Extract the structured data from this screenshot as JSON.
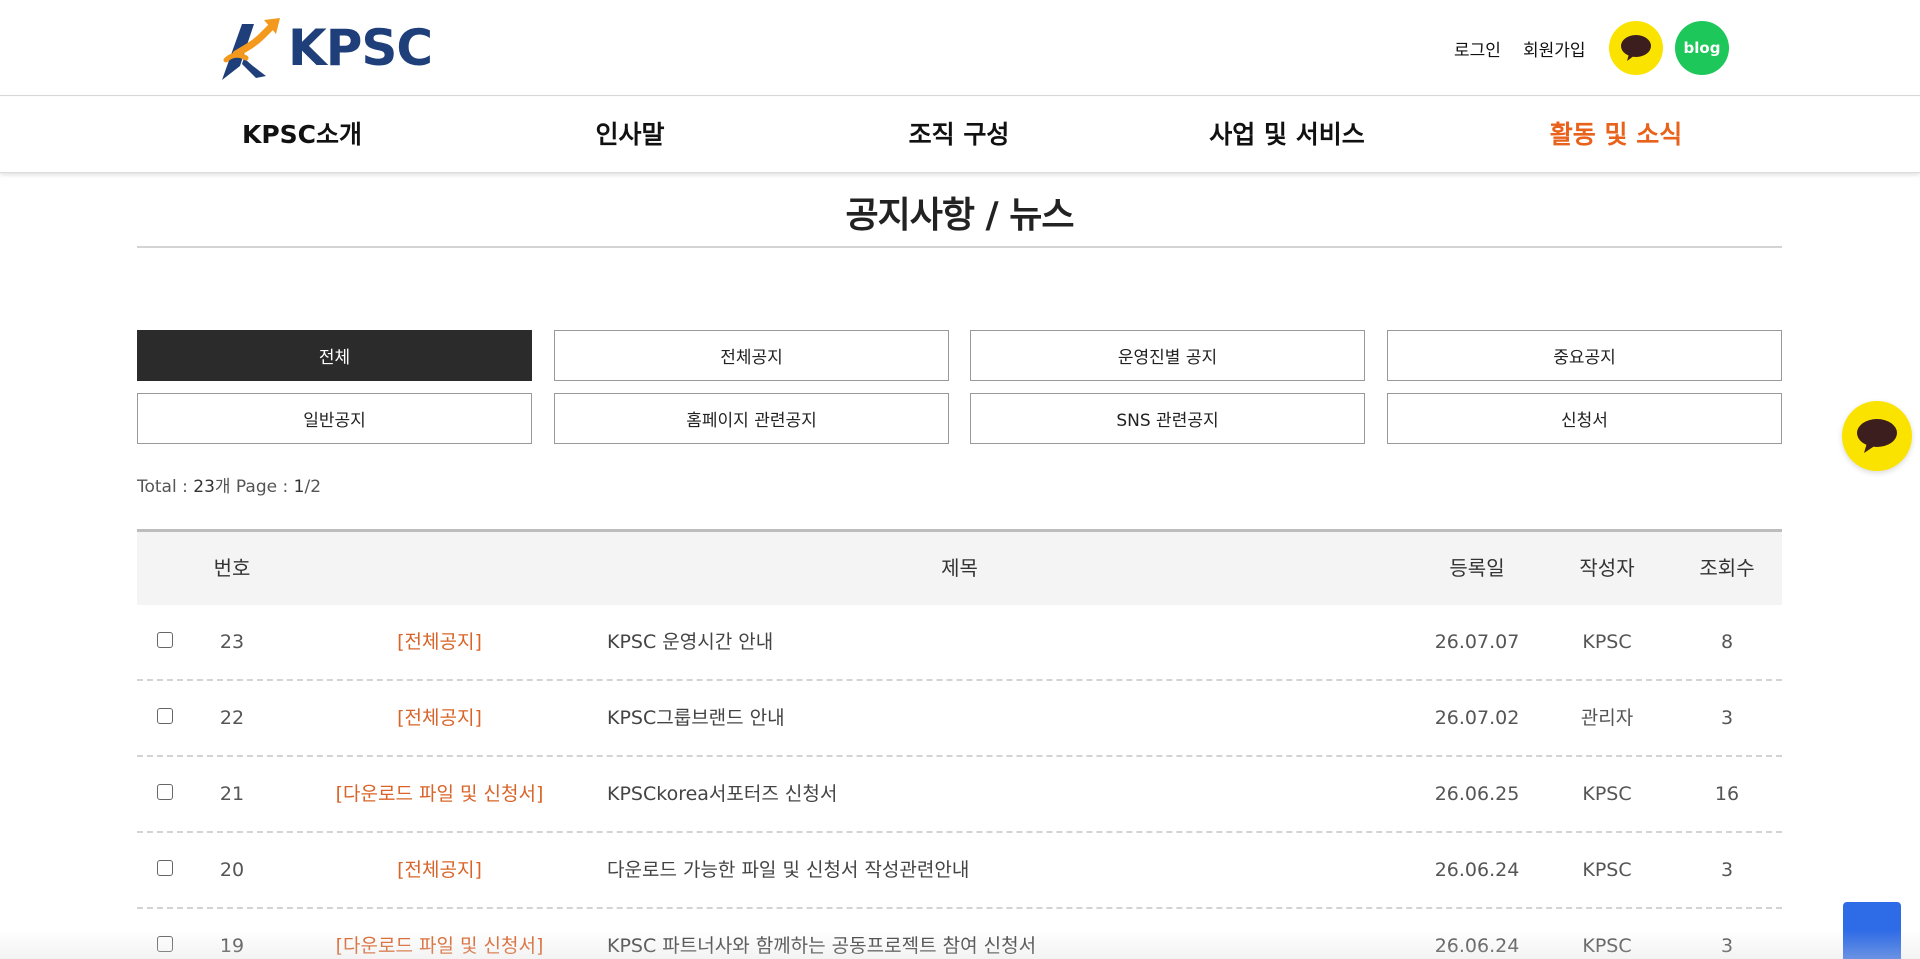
{
  "header": {
    "logo_text": "KPSC",
    "login_label": "로그인",
    "join_label": "회원가입",
    "blog_label": "blog",
    "colors": {
      "brand_blue": "#1f3f7a",
      "brand_orange": "#f39a1e",
      "kakao_yellow": "#fbe300",
      "blog_green": "#1ec75a"
    }
  },
  "nav": {
    "items": [
      {
        "label": "KPSC소개"
      },
      {
        "label": "인사말"
      },
      {
        "label": "조직 구성"
      },
      {
        "label": "사업 및 서비스"
      },
      {
        "label": "활동 및 소식"
      }
    ],
    "active_index": 4,
    "active_color": "#e8621c"
  },
  "page": {
    "title": "공지사항 / 뉴스"
  },
  "filters": [
    {
      "label": "전체",
      "active": true
    },
    {
      "label": "전체공지"
    },
    {
      "label": "운영진별 공지"
    },
    {
      "label": "중요공지"
    },
    {
      "label": "일반공지"
    },
    {
      "label": "홈페이지 관련공지"
    },
    {
      "label": "SNS 관련공지"
    },
    {
      "label": "신청서"
    }
  ],
  "summary": {
    "total_label": "Total : ",
    "total_count": "23",
    "count_unit": "개",
    "page_label": " Page : ",
    "page_current": "1",
    "page_total": "/2"
  },
  "table": {
    "headers": {
      "number": "번호",
      "subject": "제목",
      "date": "등록일",
      "writer": "작성자",
      "views": "조회수"
    },
    "rows": [
      {
        "number": "23",
        "category": "[전체공지]",
        "subject": "KPSC 운영시간 안내",
        "date": "26.07.07",
        "writer": "KPSC",
        "views": "8"
      },
      {
        "number": "22",
        "category": "[전체공지]",
        "subject": "KPSC그룹브랜드 안내",
        "date": "26.07.02",
        "writer": "관리자",
        "views": "3"
      },
      {
        "number": "21",
        "category": "[다운로드 파일 및 신청서]",
        "subject": "KPSCkorea서포터즈 신청서",
        "date": "26.06.25",
        "writer": "KPSC",
        "views": "16"
      },
      {
        "number": "20",
        "category": "[전체공지]",
        "subject": "다운로드 가능한 파일 및 신청서 작성관련안내",
        "date": "26.06.24",
        "writer": "KPSC",
        "views": "3"
      },
      {
        "number": "19",
        "category": "[다운로드 파일 및 신청서]",
        "subject": "KPSC 파트너사와 함께하는 공동프로젝트 참여 신청서",
        "date": "26.06.24",
        "writer": "KPSC",
        "views": "3"
      }
    ],
    "category_color": "#d9642a"
  },
  "icons": {
    "kakao_header": "kakao-chat-bubble-icon",
    "kakao_floating": "kakao-chat-bubble-icon",
    "scroll_top": "scroll-top-icon"
  }
}
